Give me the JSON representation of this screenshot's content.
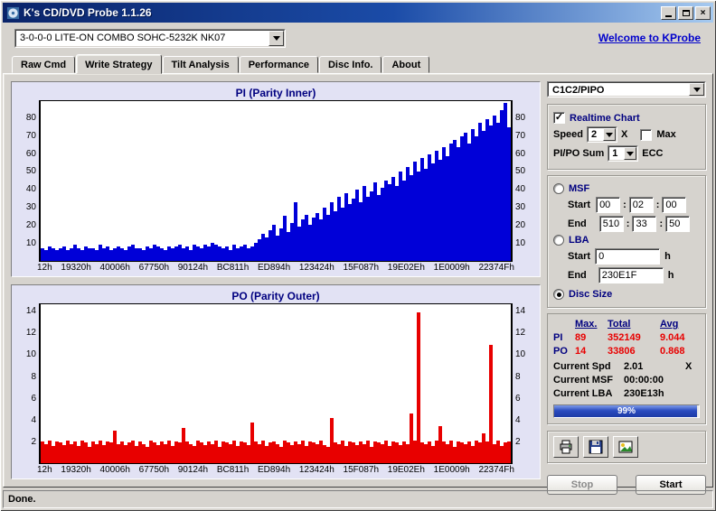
{
  "window": {
    "title": "K's CD/DVD Probe 1.1.26",
    "status": "Done."
  },
  "toolbar": {
    "drive": "3-0-0-0 LITE-ON COMBO SOHC-5232K NK07",
    "welcome_link": "Welcome to KProbe"
  },
  "tabs": [
    {
      "label": "Raw Cmd"
    },
    {
      "label": "Write Strategy"
    },
    {
      "label": "Tilt Analysis"
    },
    {
      "label": "Performance"
    },
    {
      "label": "Disc Info."
    },
    {
      "label": "About"
    }
  ],
  "side": {
    "mode": "C1C2/PIPO",
    "realtime_label": "Realtime Chart",
    "check_glyph": "✓",
    "speed_label": "Speed",
    "speed_value": "2",
    "speed_unit": "X",
    "max_label": "Max",
    "sum_label": "PI/PO Sum",
    "sum_value": "1",
    "sum_unit": "ECC",
    "msf_label": "MSF",
    "start_label": "Start",
    "end_label": "End",
    "colon": ":",
    "msf_start": [
      "00",
      "02",
      "00"
    ],
    "msf_end": [
      "510",
      "33",
      "50"
    ],
    "lba_label": "LBA",
    "lba_start": "0",
    "lba_end": "230E1F",
    "hex_unit": "h",
    "disc_size_label": "Disc Size",
    "stats": {
      "headers": [
        "Max.",
        "Total",
        "Avg"
      ],
      "rows": [
        {
          "label": "PI",
          "max": "89",
          "total": "352149",
          "avg": "9.044"
        },
        {
          "label": "PO",
          "max": "14",
          "total": "33806",
          "avg": "0.868"
        }
      ]
    },
    "current": [
      {
        "label": "Current Spd",
        "value": "2.01",
        "unit": "X"
      },
      {
        "label": "Current MSF",
        "value": "00:00:00",
        "unit": ""
      },
      {
        "label": "Current LBA",
        "value": "230E13h",
        "unit": ""
      }
    ],
    "progress": {
      "percent": 99,
      "label": "99%"
    },
    "stop_label": "Stop"
  },
  "chart_data": [
    {
      "type": "bar",
      "title": "PI (Parity Inner)",
      "color": "#0000d8",
      "ymax": 90,
      "y_ticks": [
        10,
        20,
        30,
        40,
        50,
        60,
        70,
        80
      ],
      "x_labels": [
        "12h",
        "19320h",
        "40006h",
        "67750h",
        "90124h",
        "BC811h",
        "ED894h",
        "123424h",
        "15F087h",
        "19E02Eh",
        "1E0009h",
        "22374Fh"
      ],
      "values": [
        7,
        6,
        8,
        7,
        6,
        7,
        8,
        6,
        7,
        9,
        7,
        6,
        8,
        7,
        7,
        6,
        9,
        7,
        8,
        6,
        7,
        8,
        7,
        6,
        8,
        9,
        7,
        7,
        6,
        8,
        7,
        9,
        8,
        7,
        6,
        8,
        7,
        8,
        9,
        7,
        8,
        6,
        9,
        8,
        7,
        9,
        8,
        10,
        9,
        8,
        7,
        8,
        6,
        9,
        7,
        8,
        9,
        7,
        8,
        10,
        12,
        15,
        13,
        17,
        20,
        14,
        18,
        25,
        16,
        21,
        33,
        19,
        23,
        26,
        20,
        24,
        27,
        23,
        30,
        26,
        33,
        28,
        36,
        30,
        38,
        32,
        35,
        40,
        33,
        42,
        36,
        39,
        44,
        37,
        41,
        45,
        43,
        47,
        42,
        50,
        45,
        53,
        48,
        56,
        50,
        58,
        52,
        60,
        55,
        62,
        57,
        64,
        59,
        66,
        68,
        64,
        70,
        72,
        66,
        74,
        70,
        78,
        73,
        80,
        76,
        82,
        78,
        85,
        89,
        75
      ]
    },
    {
      "type": "bar",
      "title": "PO (Parity Outer)",
      "color": "#e80000",
      "ymax": 14.8,
      "y_ticks": [
        2,
        4,
        6,
        8,
        10,
        12,
        14
      ],
      "x_labels": [
        "12h",
        "19320h",
        "40006h",
        "67750h",
        "90124h",
        "BC811h",
        "ED894h",
        "123424h",
        "15F087h",
        "19E02Eh",
        "1E0009h",
        "22374Fh"
      ],
      "values": [
        2,
        1.8,
        2.1,
        1.6,
        2,
        1.9,
        1.7,
        2.1,
        1.8,
        2,
        1.6,
        2.1,
        1.9,
        1.5,
        2,
        1.8,
        2.1,
        1.7,
        2,
        1.9,
        3,
        1.8,
        2,
        1.7,
        1.9,
        2.1,
        1.6,
        2,
        1.8,
        1.5,
        2.1,
        1.9,
        1.7,
        2,
        1.8,
        2.1,
        1.6,
        2,
        1.9,
        3.3,
        2,
        1.8,
        1.6,
        2.1,
        1.9,
        1.7,
        2,
        1.8,
        2.1,
        1.5,
        2,
        1.9,
        1.8,
        2.1,
        1.6,
        2,
        1.9,
        1.7,
        3.8,
        2,
        1.8,
        2.1,
        1.6,
        1.9,
        2,
        1.8,
        1.5,
        2.1,
        1.9,
        1.7,
        2,
        1.8,
        2.1,
        1.6,
        2,
        1.9,
        1.8,
        2.1,
        1.7,
        1.5,
        4.2,
        1.9,
        1.8,
        2.1,
        1.6,
        2,
        1.9,
        1.7,
        2,
        1.8,
        2.1,
        1.5,
        2,
        1.9,
        1.8,
        2.1,
        1.6,
        2,
        1.9,
        1.7,
        2,
        1.8,
        4.6,
        2.1,
        14,
        1.9,
        1.8,
        2,
        1.6,
        2.1,
        3.4,
        2,
        1.8,
        2.1,
        1.5,
        2,
        1.9,
        1.8,
        2,
        1.6,
        2.1,
        1.9,
        2.8,
        2,
        11,
        1.8,
        2.1,
        1.6,
        1.9,
        2
      ]
    }
  ]
}
